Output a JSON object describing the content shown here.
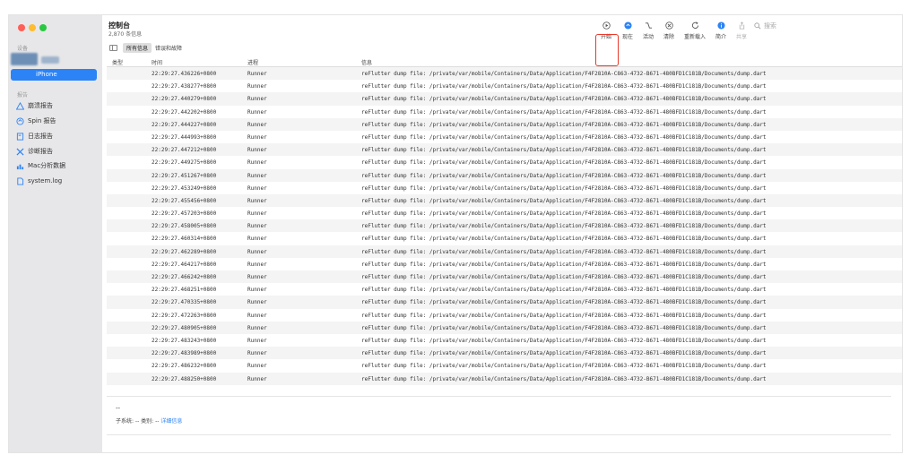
{
  "window": {
    "title": "控制台",
    "message_count": "2,870 条信息"
  },
  "sidebar": {
    "devices_header": "设备",
    "device_label": "iPhone",
    "reports_header": "报告",
    "items": [
      {
        "label": "崩溃报告",
        "icon": "warning-triangle-icon"
      },
      {
        "label": "Spin 报告",
        "icon": "spin-icon"
      },
      {
        "label": "日志报告",
        "icon": "log-book-icon"
      },
      {
        "label": "诊断报告",
        "icon": "tools-icon"
      },
      {
        "label": "Mac分析数据",
        "icon": "bar-chart-icon"
      },
      {
        "label": "system.log",
        "icon": "document-icon"
      }
    ]
  },
  "toolbar": {
    "start": "开始",
    "now": "现在",
    "activity": "活动",
    "clear": "清除",
    "reload": "重新载入",
    "info": "简介",
    "share": "共享",
    "search_placeholder": "搜索"
  },
  "filter": {
    "all_messages": "所有信息",
    "errors_faults": "错误和故障"
  },
  "table": {
    "headers": {
      "type": "类型",
      "time": "时间",
      "process": "进程",
      "message": "信息"
    },
    "rows": [
      {
        "time": "22:29:27.436226+0800",
        "process": "Runner",
        "message": "reFlutter dump file: /private/var/mobile/Containers/Data/Application/F4F2810A-C863-4732-B671-480BFD1C181B/Documents/dump.dart"
      },
      {
        "time": "22:29:27.438277+0800",
        "process": "Runner",
        "message": "reFlutter dump file: /private/var/mobile/Containers/Data/Application/F4F2810A-C863-4732-B671-480BFD1C181B/Documents/dump.dart"
      },
      {
        "time": "22:29:27.440279+0800",
        "process": "Runner",
        "message": "reFlutter dump file: /private/var/mobile/Containers/Data/Application/F4F2810A-C863-4732-B671-480BFD1C181B/Documents/dump.dart"
      },
      {
        "time": "22:29:27.442202+0800",
        "process": "Runner",
        "message": "reFlutter dump file: /private/var/mobile/Containers/Data/Application/F4F2810A-C863-4732-B671-480BFD1C181B/Documents/dump.dart"
      },
      {
        "time": "22:29:27.444227+0800",
        "process": "Runner",
        "message": "reFlutter dump file: /private/var/mobile/Containers/Data/Application/F4F2810A-C863-4732-B671-480BFD1C181B/Documents/dump.dart"
      },
      {
        "time": "22:29:27.444993+0800",
        "process": "Runner",
        "message": "reFlutter dump file: /private/var/mobile/Containers/Data/Application/F4F2810A-C863-4732-B671-480BFD1C181B/Documents/dump.dart"
      },
      {
        "time": "22:29:27.447212+0800",
        "process": "Runner",
        "message": "reFlutter dump file: /private/var/mobile/Containers/Data/Application/F4F2810A-C863-4732-B671-480BFD1C181B/Documents/dump.dart"
      },
      {
        "time": "22:29:27.449275+0800",
        "process": "Runner",
        "message": "reFlutter dump file: /private/var/mobile/Containers/Data/Application/F4F2810A-C863-4732-B671-480BFD1C181B/Documents/dump.dart"
      },
      {
        "time": "22:29:27.451267+0800",
        "process": "Runner",
        "message": "reFlutter dump file: /private/var/mobile/Containers/Data/Application/F4F2810A-C863-4732-B671-480BFD1C181B/Documents/dump.dart"
      },
      {
        "time": "22:29:27.453249+0800",
        "process": "Runner",
        "message": "reFlutter dump file: /private/var/mobile/Containers/Data/Application/F4F2810A-C863-4732-B671-480BFD1C181B/Documents/dump.dart"
      },
      {
        "time": "22:29:27.455456+0800",
        "process": "Runner",
        "message": "reFlutter dump file: /private/var/mobile/Containers/Data/Application/F4F2810A-C863-4732-B671-480BFD1C181B/Documents/dump.dart"
      },
      {
        "time": "22:29:27.457203+0800",
        "process": "Runner",
        "message": "reFlutter dump file: /private/var/mobile/Containers/Data/Application/F4F2810A-C863-4732-B671-480BFD1C181B/Documents/dump.dart"
      },
      {
        "time": "22:29:27.458005+0800",
        "process": "Runner",
        "message": "reFlutter dump file: /private/var/mobile/Containers/Data/Application/F4F2810A-C863-4732-B671-480BFD1C181B/Documents/dump.dart"
      },
      {
        "time": "22:29:27.460314+0800",
        "process": "Runner",
        "message": "reFlutter dump file: /private/var/mobile/Containers/Data/Application/F4F2810A-C863-4732-B671-480BFD1C181B/Documents/dump.dart"
      },
      {
        "time": "22:29:27.462289+0800",
        "process": "Runner",
        "message": "reFlutter dump file: /private/var/mobile/Containers/Data/Application/F4F2810A-C863-4732-B671-480BFD1C181B/Documents/dump.dart"
      },
      {
        "time": "22:29:27.464217+0800",
        "process": "Runner",
        "message": "reFlutter dump file: /private/var/mobile/Containers/Data/Application/F4F2810A-C863-4732-B671-480BFD1C181B/Documents/dump.dart"
      },
      {
        "time": "22:29:27.466242+0800",
        "process": "Runner",
        "message": "reFlutter dump file: /private/var/mobile/Containers/Data/Application/F4F2810A-C863-4732-B671-480BFD1C181B/Documents/dump.dart"
      },
      {
        "time": "22:29:27.468251+0800",
        "process": "Runner",
        "message": "reFlutter dump file: /private/var/mobile/Containers/Data/Application/F4F2810A-C863-4732-B671-480BFD1C181B/Documents/dump.dart"
      },
      {
        "time": "22:29:27.470335+0800",
        "process": "Runner",
        "message": "reFlutter dump file: /private/var/mobile/Containers/Data/Application/F4F2810A-C863-4732-B671-480BFD1C181B/Documents/dump.dart"
      },
      {
        "time": "22:29:27.472263+0800",
        "process": "Runner",
        "message": "reFlutter dump file: /private/var/mobile/Containers/Data/Application/F4F2810A-C863-4732-B671-480BFD1C181B/Documents/dump.dart"
      },
      {
        "time": "22:29:27.480905+0800",
        "process": "Runner",
        "message": "reFlutter dump file: /private/var/mobile/Containers/Data/Application/F4F2810A-C863-4732-B671-480BFD1C181B/Documents/dump.dart"
      },
      {
        "time": "22:29:27.483243+0800",
        "process": "Runner",
        "message": "reFlutter dump file: /private/var/mobile/Containers/Data/Application/F4F2810A-C863-4732-B671-480BFD1C181B/Documents/dump.dart"
      },
      {
        "time": "22:29:27.483989+0800",
        "process": "Runner",
        "message": "reFlutter dump file: /private/var/mobile/Containers/Data/Application/F4F2810A-C863-4732-B671-480BFD1C181B/Documents/dump.dart"
      },
      {
        "time": "22:29:27.486232+0800",
        "process": "Runner",
        "message": "reFlutter dump file: /private/var/mobile/Containers/Data/Application/F4F2810A-C863-4732-B671-480BFD1C181B/Documents/dump.dart"
      },
      {
        "time": "22:29:27.488250+0800",
        "process": "Runner",
        "message": "reFlutter dump file: /private/var/mobile/Containers/Data/Application/F4F2810A-C863-4732-B671-480BFD1C181B/Documents/dump.dart"
      }
    ]
  },
  "detail": {
    "placeholder": "--",
    "subsystem_line": "子系统: --  类别: --",
    "details_link": "详细信息"
  },
  "colors": {
    "accent": "#2b83f6",
    "highlight_box": "#e8392b",
    "traffic_red": "#fe5f57",
    "traffic_yellow": "#febc2e",
    "traffic_green": "#28c840"
  }
}
